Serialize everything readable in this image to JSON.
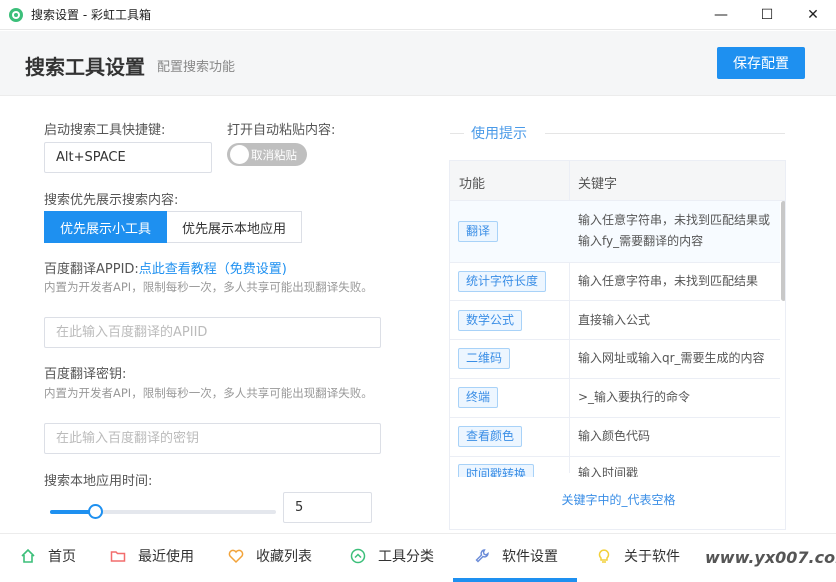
{
  "window": {
    "title": "搜索设置 - 彩虹工具箱",
    "minimize": "—",
    "maximize": "☐",
    "close": "✕"
  },
  "header": {
    "title": "搜索工具设置",
    "subtitle": "配置搜索功能",
    "save_label": "保存配置"
  },
  "form": {
    "hotkey_label": "启动搜索工具快捷键:",
    "hotkey_value": "Alt+SPACE",
    "autopaste_label": "打开自动粘贴内容:",
    "autopaste_toggle_text": "取消粘贴",
    "priority_label": "搜索优先展示搜索内容:",
    "priority_options": [
      "优先展示小工具",
      "优先展示本地应用"
    ],
    "appid_label": "百度翻译APPID:",
    "appid_link": "点此查看教程（免费设置)",
    "appid_hint": "内置为开发者API，限制每秒一次，多人共享可能出现翻译失败。",
    "appid_placeholder": "在此输入百度翻译的APIID",
    "secret_label": "百度翻译密钥:",
    "secret_hint": "内置为开发者API，限制每秒一次，多人共享可能出现翻译失败。",
    "secret_placeholder": "在此输入百度翻译的密钥",
    "search_time_label": "搜索本地应用时间:",
    "search_time_value": "5",
    "search_time_fraction": 0.2
  },
  "tips": {
    "title": "使用提示",
    "columns": [
      "功能",
      "关键字"
    ],
    "rows": [
      {
        "tag": "翻译",
        "kw": "输入任意字符串，未找到匹配结果或输入fy_需要翻译的内容"
      },
      {
        "tag": "统计字符长度",
        "kw": "输入任意字符串，未找到匹配结果"
      },
      {
        "tag": "数学公式",
        "kw": "直接输入公式"
      },
      {
        "tag": "二维码",
        "kw": "输入网址或输入qr_需要生成的内容"
      },
      {
        "tag": "终端",
        "kw": ">_输入要执行的命令"
      },
      {
        "tag": "查看颜色",
        "kw": "输入颜色代码"
      },
      {
        "tag": "时间戳转换",
        "kw": "输入时间戳"
      }
    ],
    "footer": "关键字中的_代表空格"
  },
  "nav": {
    "items": [
      {
        "label": "首页",
        "icon": "home-icon",
        "color": "#3cbf7a"
      },
      {
        "label": "最近使用",
        "icon": "folder-icon",
        "color": "#f26d6d"
      },
      {
        "label": "收藏列表",
        "icon": "heart-icon",
        "color": "#f2a33a"
      },
      {
        "label": "工具分类",
        "icon": "chevron-circle-icon",
        "color": "#3cbf7a"
      },
      {
        "label": "软件设置",
        "icon": "wrench-icon",
        "color": "#6a8bd8"
      },
      {
        "label": "关于软件",
        "icon": "bulb-icon",
        "color": "#f2d03a"
      }
    ],
    "active_index": 4
  },
  "watermark": "www.yx007.com"
}
